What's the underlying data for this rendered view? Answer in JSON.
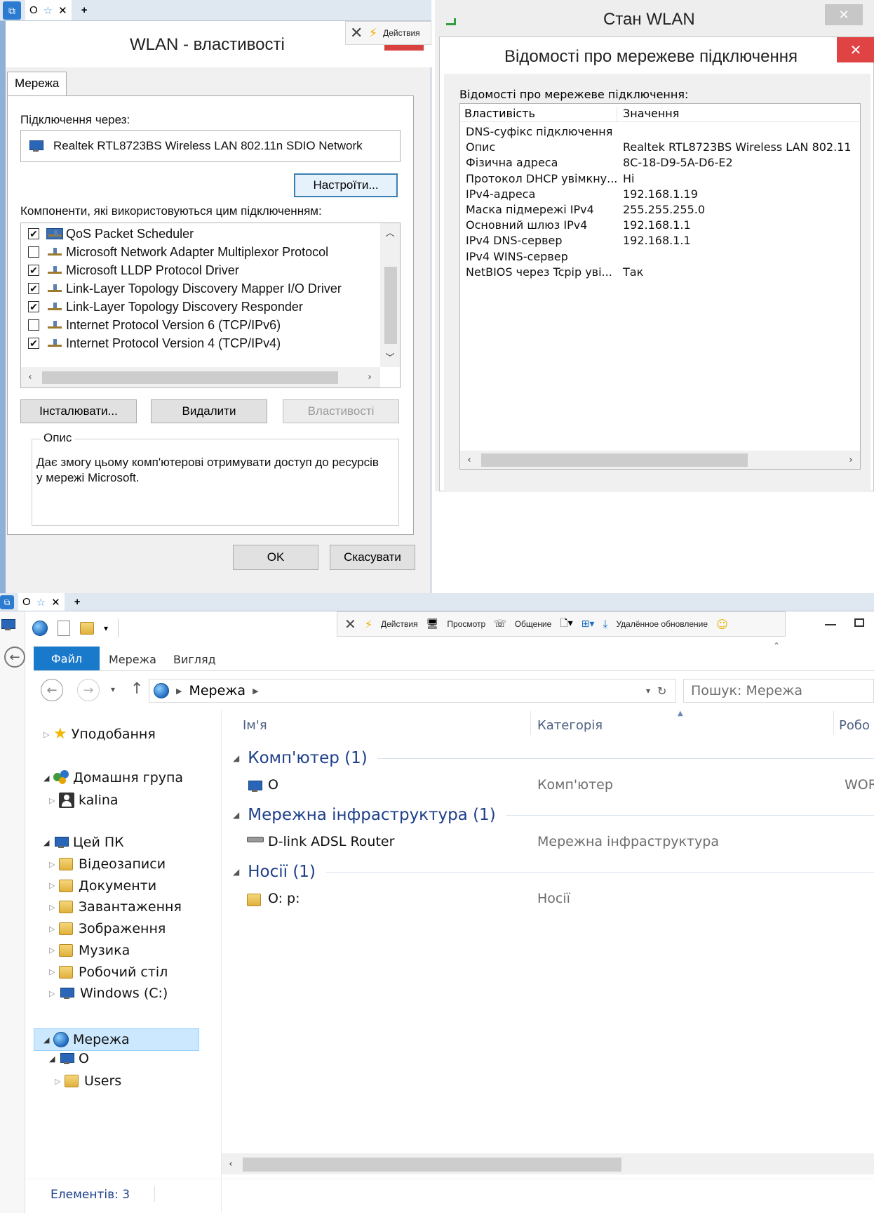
{
  "remote_strip_top": {
    "o_label": "O",
    "close_glyph": "✕",
    "plus_glyph": "+"
  },
  "remote_toolbar_top": {
    "actions_label": "Действия"
  },
  "wlan_properties": {
    "title": "WLAN - властивості",
    "tab_label": "Мережа",
    "connect_using_label": "Підключення через:",
    "adapter_name": "Realtek RTL8723BS Wireless LAN 802.11n SDIO Network",
    "configure_button": "Настроїти...",
    "components_label": "Компоненти, які використовуються цим підключенням:",
    "components": [
      {
        "label": "QoS Packet Scheduler",
        "checked": true,
        "icon": "qos-icon"
      },
      {
        "label": "Microsoft Network Adapter Multiplexor Protocol",
        "checked": false,
        "icon": "protocol-icon"
      },
      {
        "label": "Microsoft LLDP Protocol Driver",
        "checked": true,
        "icon": "protocol-icon"
      },
      {
        "label": "Link-Layer Topology Discovery Mapper I/O Driver",
        "checked": true,
        "icon": "protocol-icon"
      },
      {
        "label": "Link-Layer Topology Discovery Responder",
        "checked": true,
        "icon": "protocol-icon"
      },
      {
        "label": "Internet Protocol Version 6 (TCP/IPv6)",
        "checked": false,
        "icon": "protocol-icon"
      },
      {
        "label": "Internet Protocol Version 4 (TCP/IPv4)",
        "checked": true,
        "icon": "protocol-icon"
      }
    ],
    "install_button": "Інсталювати...",
    "remove_button": "Видалити",
    "properties_button": "Властивості",
    "description_legend": "Опис",
    "description_text": "Дає змогу цьому комп'ютерові отримувати доступ до ресурсів у мережі Microsoft.",
    "ok_button": "OK",
    "cancel_button": "Скасувати"
  },
  "wlan_status": {
    "title": "Стан WLAN",
    "details_title": "Відомості про мережеве підключення",
    "details_label": "Відомості про мережеве підключення:",
    "columns": [
      "Властивість",
      "Значення"
    ],
    "rows": [
      {
        "property": "DNS-суфікс підключення",
        "value": ""
      },
      {
        "property": "Опис",
        "value": "Realtek RTL8723BS Wireless LAN 802.11"
      },
      {
        "property": "Фізична адреса",
        "value": "8C-18-D9-5A-D6-E2"
      },
      {
        "property": "Протокол DHCP увімкну...",
        "value": "Ні"
      },
      {
        "property": "IPv4-адреса",
        "value": "192.168.1.19"
      },
      {
        "property": "Маска підмережі IPv4",
        "value": "255.255.255.0"
      },
      {
        "property": "Основний шлюз IPv4",
        "value": "192.168.1.1"
      },
      {
        "property": "IPv4 DNS-сервер",
        "value": "192.168.1.1"
      },
      {
        "property": "IPv4 WINS-сервер",
        "value": ""
      },
      {
        "property": "NetBIOS через Tcpip увi...",
        "value": "Так"
      }
    ]
  },
  "remote_strip_bottom": {
    "o_label": "O",
    "close_glyph": "✕",
    "plus_glyph": "+"
  },
  "remote_toolbar_bottom": {
    "actions": "Действия",
    "view": "Просмотр",
    "communication": "Общение",
    "remote_update": "Удалённое обновление"
  },
  "explorer": {
    "ribbon_tabs": [
      "Файл",
      "Мережа",
      "Вигляд"
    ],
    "breadcrumb": "Мережа",
    "search_placeholder": "Пошук: Мережа",
    "nav": {
      "favorites": "Уподобання",
      "homegroup": "Домашня група",
      "homegroup_user": "kalina",
      "this_pc": "Цей ПК",
      "this_pc_items": [
        "Відеозаписи",
        "Документи",
        "Завантаження",
        "Зображення",
        "Музика",
        "Робочий стіл",
        "Windows (C:)"
      ],
      "network": "Мережа",
      "network_computer": "O",
      "network_share": "Users"
    },
    "columns": [
      "Ім'я",
      "Категорія",
      "Робо"
    ],
    "groups": [
      {
        "title": "Комп'ютер (1)",
        "items": [
          {
            "name": "O",
            "category": "Комп'ютер",
            "extra": "WOR"
          }
        ]
      },
      {
        "title": "Мережна інфраструктура (1)",
        "items": [
          {
            "name": "D-link ADSL Router",
            "category": "Мережна інфраструктура",
            "extra": ""
          }
        ]
      },
      {
        "title": "Носії (1)",
        "items": [
          {
            "name": "O: p:",
            "category": "Носії",
            "extra": ""
          }
        ]
      }
    ],
    "status": "Елементів: 3"
  }
}
